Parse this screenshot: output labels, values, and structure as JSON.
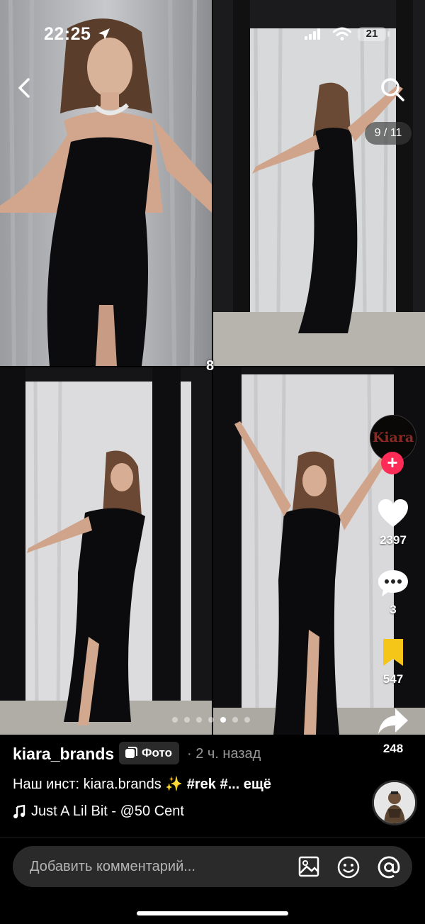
{
  "status_bar": {
    "time": "22:25",
    "battery": "21"
  },
  "pager": {
    "counter": "9 / 11",
    "group_label": "8",
    "dot_count": 7,
    "active_dot": 4
  },
  "creator": {
    "avatar_text": "Kiara",
    "follow_symbol": "+"
  },
  "actions": {
    "likes": "2397",
    "comments": "3",
    "saves": "547",
    "shares": "248"
  },
  "post": {
    "author": "kiara_brands",
    "type_badge": "Фото",
    "posted": "· 2 ч. назад",
    "caption_text": "Наш инст: kiara.brands ✨ ",
    "caption_tags": "#rek #...",
    "caption_more": " ещё",
    "music": "Just A Lil Bit - @50 Cent"
  },
  "comment_bar": {
    "placeholder": "Добавить комментарий..."
  },
  "icons": [
    "back-icon",
    "search-icon",
    "location-icon",
    "signal-icon",
    "wifi-icon",
    "heart-icon",
    "comment-icon",
    "bookmark-icon",
    "share-icon",
    "photo-icon",
    "music-note-icon",
    "image-icon",
    "emoji-icon",
    "mention-icon"
  ],
  "colors": {
    "accent_pink": "#ff2b57",
    "bookmark_yellow": "#f5c518",
    "bar_bg": "#2a2a2a"
  }
}
